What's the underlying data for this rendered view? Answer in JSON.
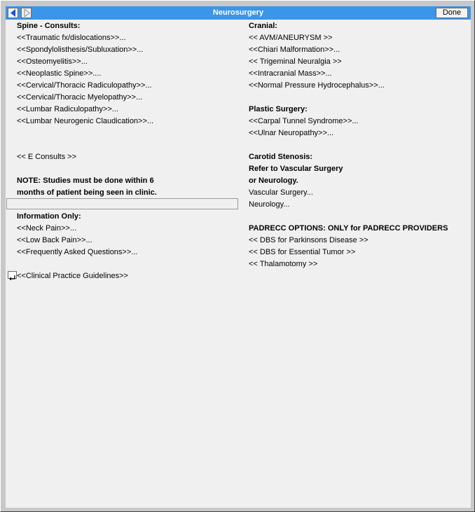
{
  "window": {
    "title": "Neurosurgery",
    "done_label": "Done"
  },
  "left": {
    "spine": {
      "header": "Spine - Consults:",
      "items": [
        "<<Traumatic fx/dislocations>>...",
        "<<Spondylolisthesis/Subluxation>>...",
        "<<Osteomyelitis>>...",
        "<<Neoplastic Spine>>....",
        "<<Cervical/Thoracic Radiculopathy>>...",
        "<<Cervical/Thoracic Myelopathy>>...",
        "<<Lumbar Radiculopathy>>...",
        "<<Lumbar Neurogenic Claudication>>..."
      ]
    },
    "e_consults": "<< E Consults >>",
    "note": {
      "line1": "NOTE: Studies must be done within 6",
      "line2": "months of patient being seen in clinic."
    },
    "info": {
      "header": "Information Only:",
      "items": [
        "<<Neck Pain>>...",
        "<<Low Back Pain>>...",
        "<<Frequently Asked Questions>>..."
      ]
    },
    "guidelines": "<<Clinical Practice Guidelines>>"
  },
  "right": {
    "cranial": {
      "header": "Cranial:",
      "items": [
        "<< AVM/ANEURYSM >>",
        "<<Chiari Malformation>>...",
        "<< Trigeminal Neuralgia >>",
        "<<Intracranial Mass>>...",
        "<<Normal Pressure Hydrocephalus>>..."
      ]
    },
    "plastic": {
      "header": "Plastic Surgery:",
      "items": [
        "<<Carpal Tunnel Syndrome>>...",
        "<<Ulnar Neuropathy>>..."
      ]
    },
    "carotid": {
      "line1": "Carotid Stenosis:",
      "line2": "Refer to Vascular Surgery",
      "line3": "or Neurology.",
      "items": [
        "Vascular Surgery...",
        "Neurology..."
      ]
    },
    "padrecc": {
      "header": "PADRECC OPTIONS: ONLY for PADRECC PROVIDERS",
      "items": [
        "<< DBS for Parkinsons Disease >>",
        "<< DBS for Essential Tumor >>",
        "<< Thalamotomy >>"
      ]
    }
  }
}
